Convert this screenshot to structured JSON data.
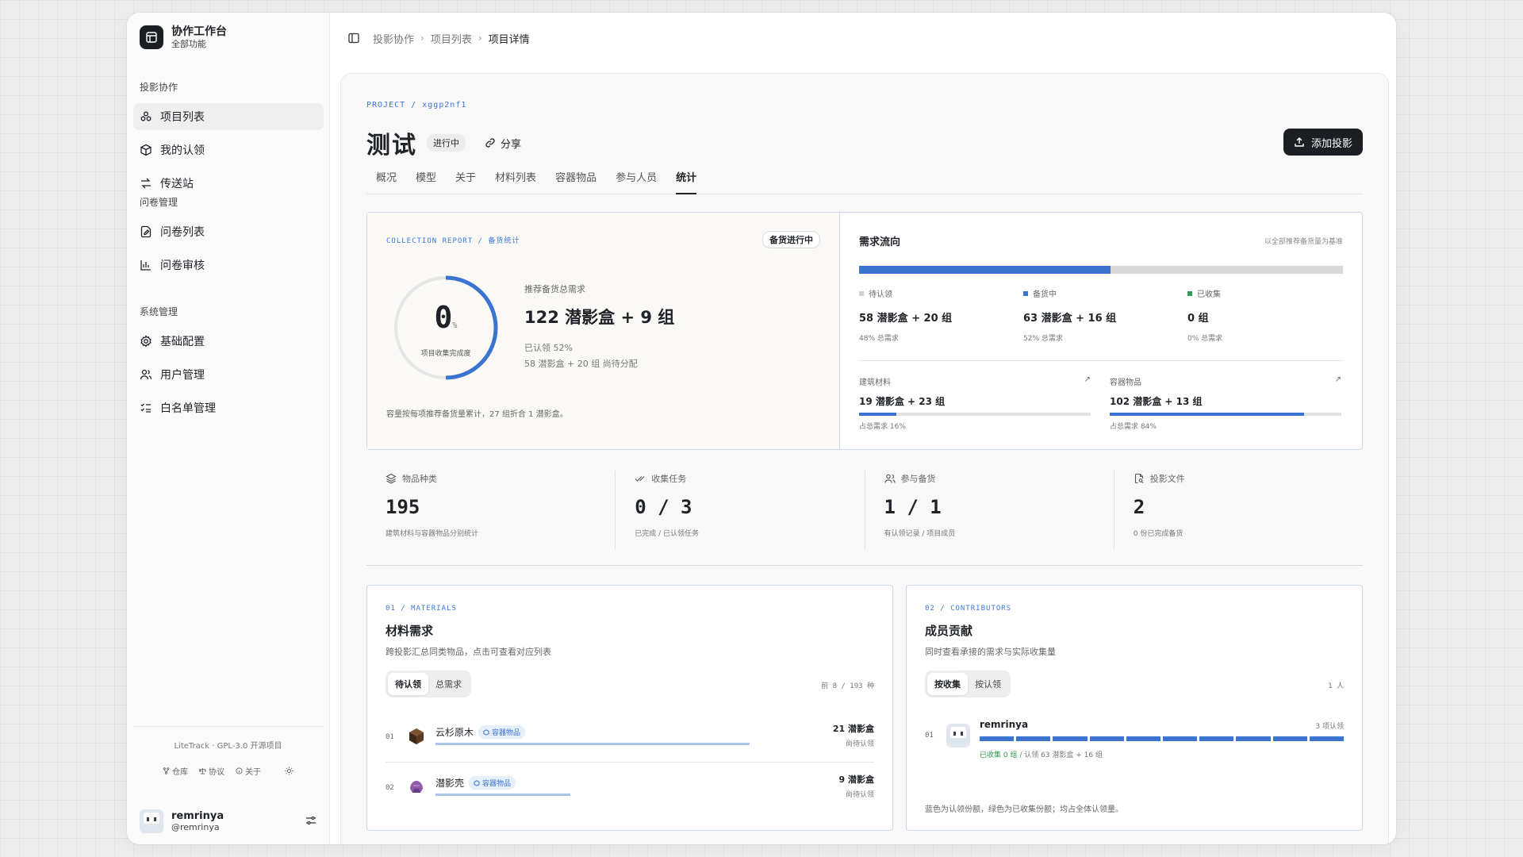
{
  "sidebar": {
    "brand_title": "协作工作台",
    "brand_sub": "全部功能",
    "groups": [
      {
        "label": "投影协作",
        "items": [
          {
            "label": "项目列表",
            "active": true
          },
          {
            "label": "我的认领"
          },
          {
            "label": "传送站"
          }
        ]
      },
      {
        "label": "问卷管理",
        "items": [
          {
            "label": "问卷列表"
          },
          {
            "label": "问卷审核"
          }
        ]
      },
      {
        "label": "系统管理",
        "items": [
          {
            "label": "基础配置"
          },
          {
            "label": "用户管理"
          },
          {
            "label": "白名单管理"
          }
        ]
      }
    ],
    "license": "LiteTrack · GPL-3.0 开源项目",
    "links": {
      "repo": "仓库",
      "agreement": "协议",
      "about": "关于"
    },
    "user": {
      "name": "remrinya",
      "handle": "@remrinya"
    }
  },
  "breadcrumb": [
    "投影协作",
    "项目列表",
    "项目详情"
  ],
  "project": {
    "tag": "PROJECT / xggp2nf1",
    "title": "测试",
    "status": "进行中",
    "share": "分享",
    "add_button": "添加投影"
  },
  "tabs": [
    "概况",
    "模型",
    "关于",
    "材料列表",
    "容器物品",
    "参与人员",
    "统计"
  ],
  "active_tab": "统计",
  "report": {
    "tag": "COLLECTION REPORT / 备货统计",
    "badge": "备货进行中",
    "percent": "0",
    "percent_unit": "%",
    "percent_value": 0,
    "ring_label": "项目收集完成度",
    "need_label": "推荐备货总需求",
    "need_value": "122 潜影盒 + 9 组",
    "claimed": "已认领 52%",
    "pending": "58 潜影盒 + 20 组 尚待分配",
    "note": "容量按每项推荐备货量累计，27 组折合 1 潜影盒。"
  },
  "flow": {
    "title": "需求流向",
    "base": "以全部推荐备货量为基准",
    "fill_ratio": 0.52,
    "stats": [
      {
        "label": "待认领",
        "value": "58 潜影盒 + 20 组",
        "pct": "48% 总需求",
        "color": "#d0d0d0"
      },
      {
        "label": "备货中",
        "value": "63 潜影盒 + 16 组",
        "pct": "52% 总需求",
        "color": "#3a74d0"
      },
      {
        "label": "已收集",
        "value": "0 组",
        "pct": "0% 总需求",
        "color": "#2e9d4f"
      }
    ],
    "categories": [
      {
        "label": "建筑材料",
        "value": "19 潜影盒 + 23 组",
        "pct": "占总需求 16%",
        "ratio": 0.16
      },
      {
        "label": "容器物品",
        "value": "102 潜影盒 + 13 组",
        "pct": "占总需求 84%",
        "ratio": 0.84
      }
    ]
  },
  "stats": [
    {
      "label": "物品种类",
      "value": "195",
      "sub": "建筑材料与容器物品分别统计"
    },
    {
      "label": "收集任务",
      "value": "0 / 3",
      "sub": "已完成 / 已认领任务"
    },
    {
      "label": "参与备货",
      "value": "1 / 1",
      "sub": "有认领记录 / 项目成员"
    },
    {
      "label": "投影文件",
      "value": "2",
      "sub": "0 份已完成备货"
    }
  ],
  "materials": {
    "tag": "01 / MATERIALS",
    "title": "材料需求",
    "desc": "跨投影汇总同类物品，点击可查看对应列表",
    "seg": [
      "待认领",
      "总需求"
    ],
    "count": "前 8 / 193 种",
    "rows": [
      {
        "idx": "01",
        "name": "云杉原木",
        "chip": "容器物品",
        "amount": "21 潜影盒",
        "status": "尚待认领",
        "ratio": 1.0
      },
      {
        "idx": "02",
        "name": "潜影壳",
        "chip": "容器物品",
        "amount": "9 潜影盒",
        "status": "尚待认领",
        "ratio": 0.43
      }
    ]
  },
  "contributors": {
    "tag": "02 / CONTRIBUTORS",
    "title": "成员贡献",
    "desc": "同时查看承接的需求与实际收集量",
    "seg": [
      "按收集",
      "按认领"
    ],
    "count": "1 人",
    "member": {
      "idx": "01",
      "name": "remrinya",
      "claims": "3 项认领",
      "collected": "已收集 0 组",
      "claimed": " / 认领 63 潜影盒 + 16 组"
    },
    "note": "蓝色为认领份额，绿色为已收集份额；均占全体认领量。"
  }
}
